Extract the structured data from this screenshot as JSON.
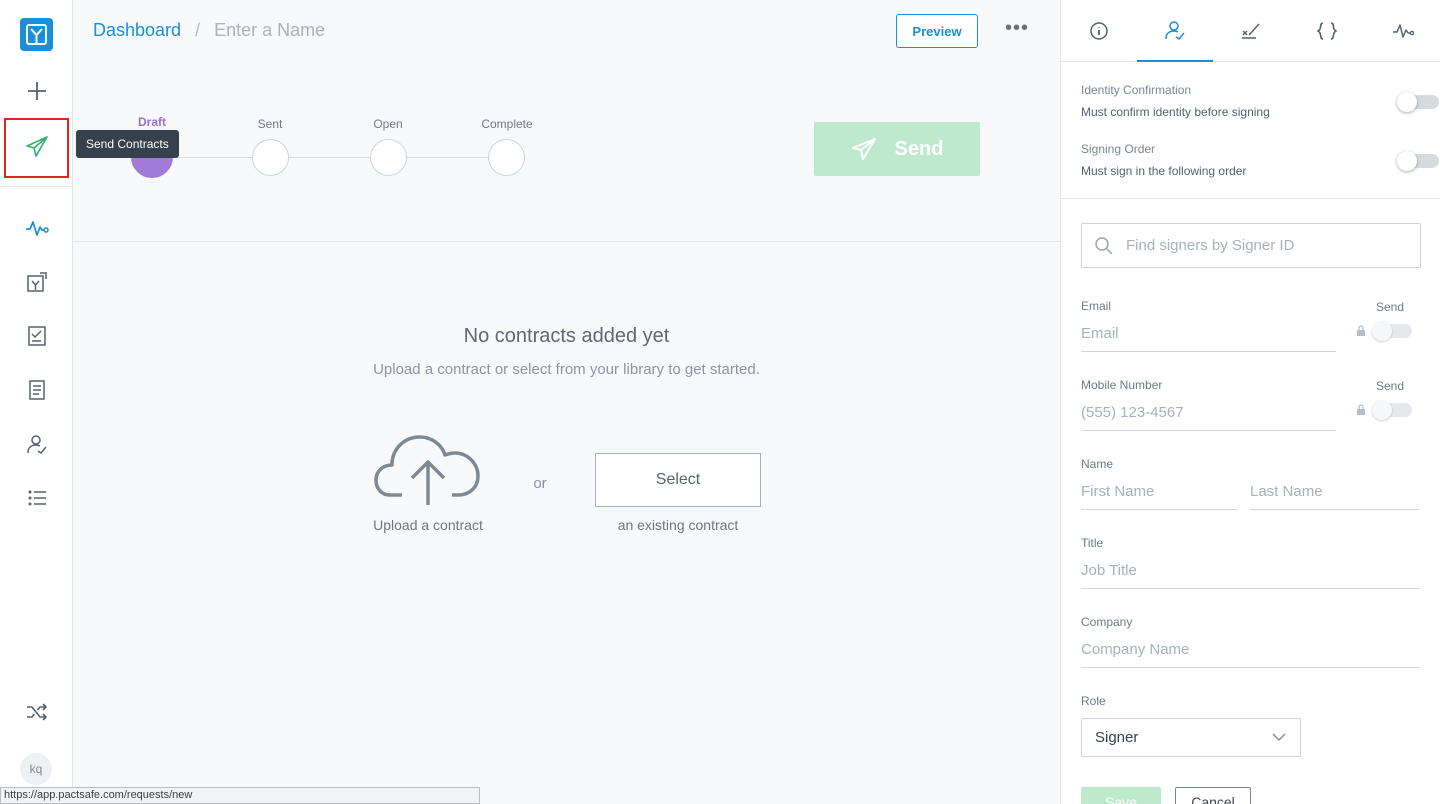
{
  "nav": {
    "items": [
      {
        "icon": "logo-icon"
      },
      {
        "icon": "plus-icon"
      },
      {
        "icon": "send-icon"
      },
      {
        "icon": "activity-icon"
      },
      {
        "icon": "contract-upload-icon"
      },
      {
        "icon": "checklist-icon"
      },
      {
        "icon": "document-icon"
      },
      {
        "icon": "signer-icon"
      },
      {
        "icon": "list-icon"
      },
      {
        "icon": "shuffle-icon"
      }
    ],
    "tooltip": "Send Contracts",
    "avatar_initials": "kq"
  },
  "header": {
    "breadcrumb_home": "Dashboard",
    "breadcrumb_sep": "/",
    "name_placeholder": "Enter a Name",
    "preview_label": "Preview",
    "more_label": "•••"
  },
  "stepper": {
    "steps": [
      {
        "label": "Draft",
        "active": true
      },
      {
        "label": "Sent",
        "active": false
      },
      {
        "label": "Open",
        "active": false
      },
      {
        "label": "Complete",
        "active": false
      }
    ],
    "send_label": "Send"
  },
  "empty_state": {
    "title": "No contracts added yet",
    "subtitle": "Upload a contract or select from your library to get started.",
    "upload_label": "Upload a contract",
    "or_label": "or",
    "select_label": "Select",
    "select_caption": "an existing contract"
  },
  "status_url": "https://app.pactsafe.com/requests/new",
  "right_panel": {
    "tabs": [
      {
        "icon": "info-icon"
      },
      {
        "icon": "signer-tab-icon"
      },
      {
        "icon": "signature-icon"
      },
      {
        "icon": "braces-icon"
      },
      {
        "icon": "activity-tab-icon"
      }
    ],
    "identity": {
      "title": "Identity Confirmation",
      "desc": "Must confirm identity before signing"
    },
    "signing_order": {
      "title": "Signing Order",
      "desc": "Must sign in the following order"
    },
    "search_placeholder": "Find signers by Signer ID",
    "email": {
      "label": "Email",
      "placeholder": "Email",
      "send_label": "Send"
    },
    "mobile": {
      "label": "Mobile Number",
      "placeholder": "(555) 123-4567",
      "send_label": "Send"
    },
    "name": {
      "label": "Name",
      "first_placeholder": "First Name",
      "last_placeholder": "Last Name"
    },
    "title": {
      "label": "Title",
      "placeholder": "Job Title"
    },
    "company": {
      "label": "Company",
      "placeholder": "Company Name"
    },
    "role": {
      "label": "Role",
      "value": "Signer"
    },
    "save_label": "Save",
    "cancel_label": "Cancel"
  },
  "colors": {
    "accent": "#1a8fd6",
    "send_green": "#bfe9cc",
    "draft_purple": "#a27ad8",
    "nav_send_green": "#2fb36a"
  }
}
